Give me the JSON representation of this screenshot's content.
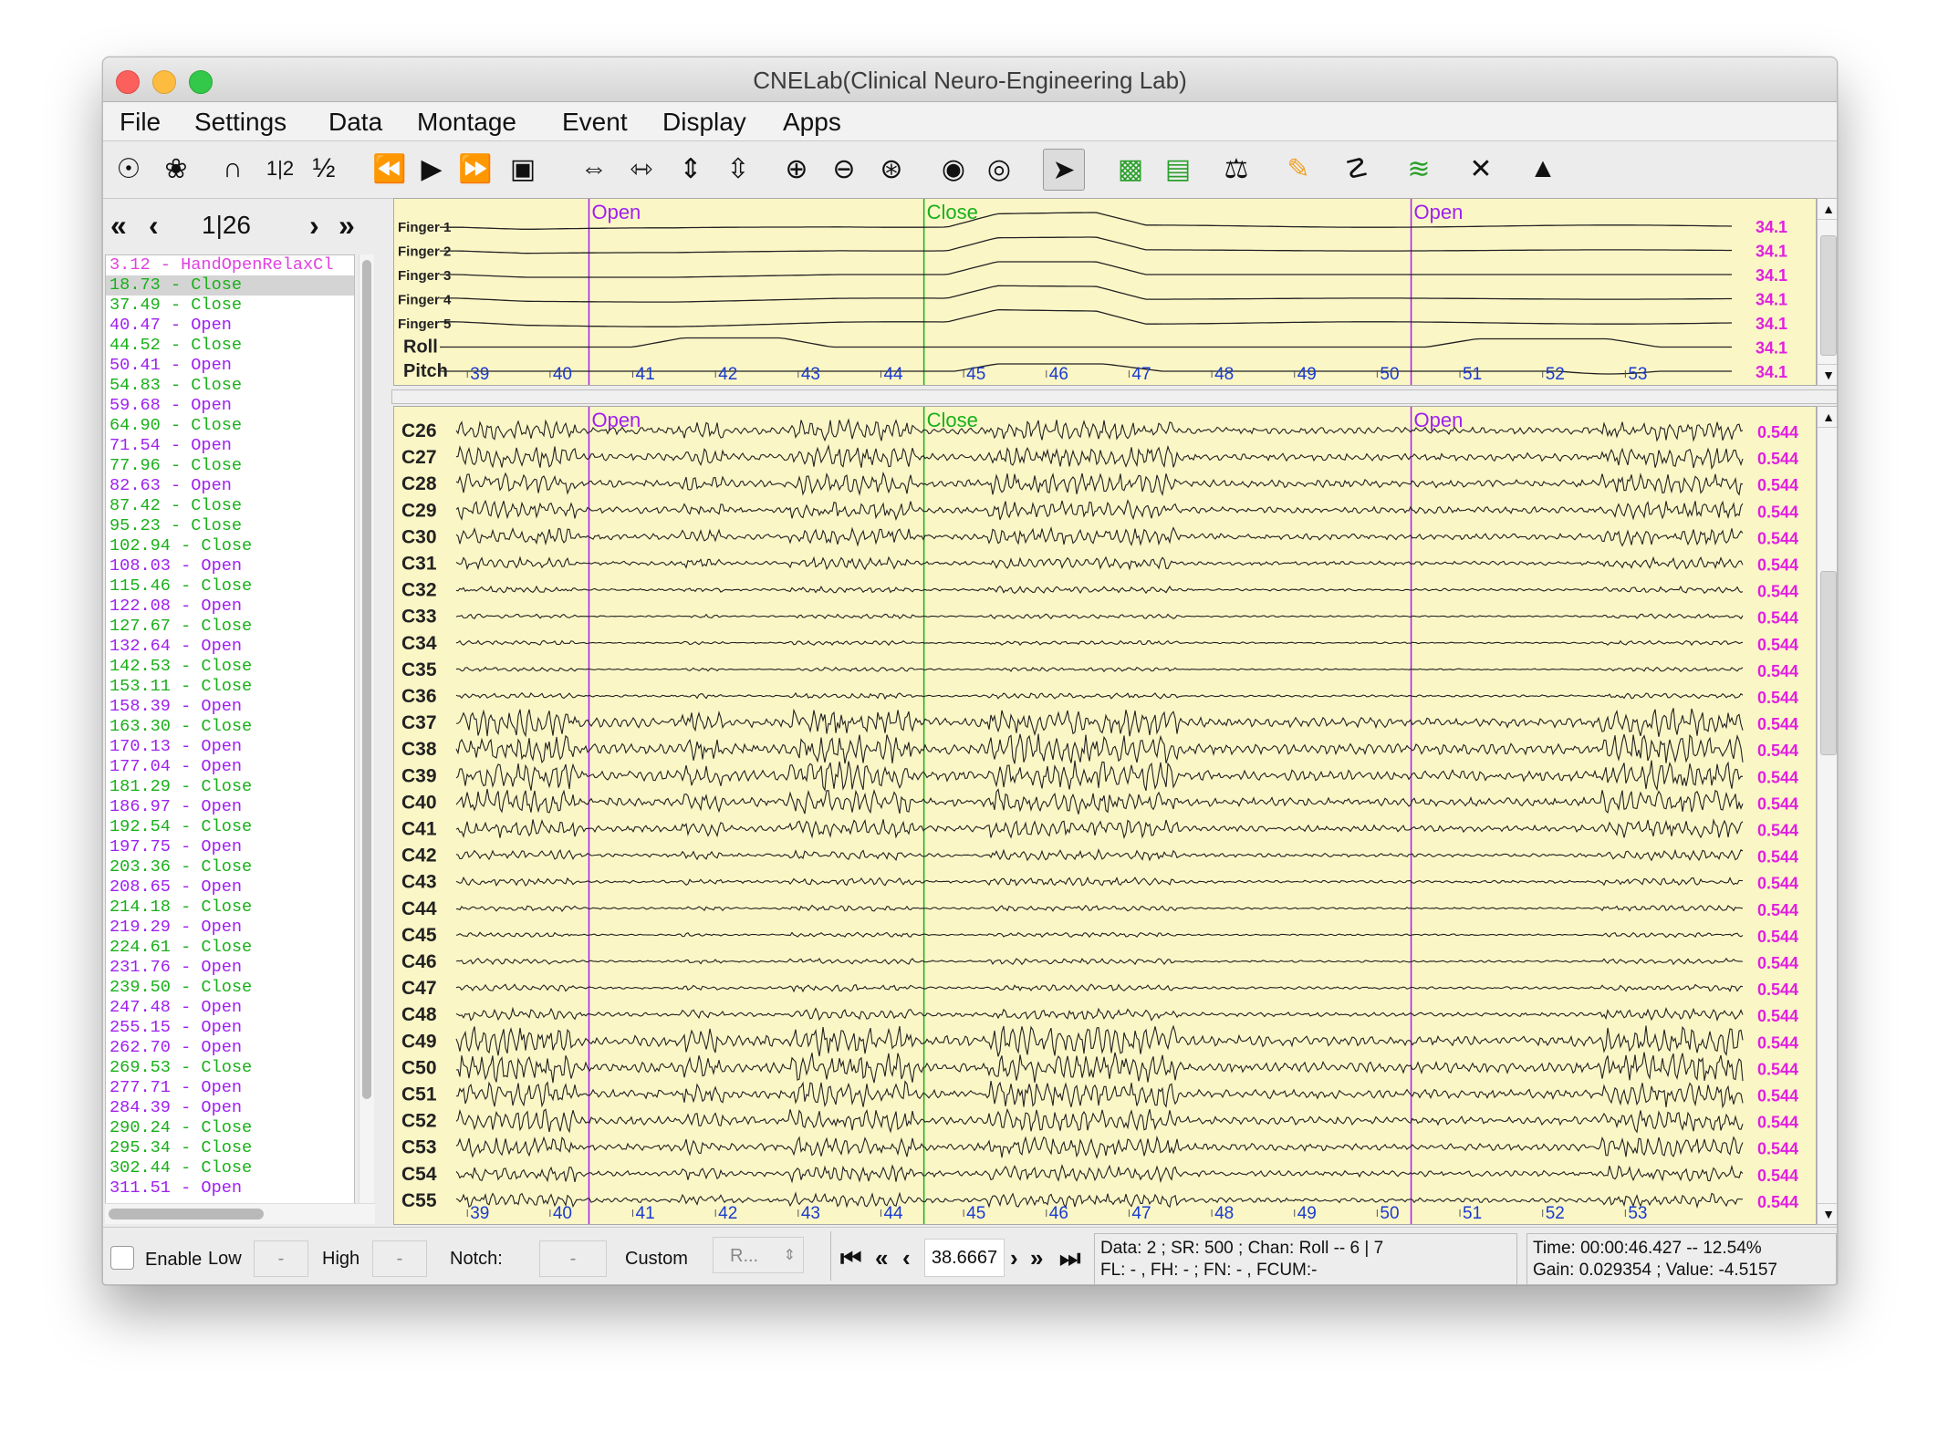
{
  "window": {
    "title": "CNELab(Clinical Neuro-Engineering Lab)"
  },
  "menu": [
    "File",
    "Settings",
    "Data",
    "Montage",
    "Event",
    "Display",
    "Apps"
  ],
  "toolbar": {
    "icons": [
      "electrode-map-icon",
      "electrode-grid-icon",
      "arc-icon",
      "page-1-2-icon",
      "half-icon",
      "rewind-icon",
      "play-icon",
      "fast-forward-icon",
      "video-icon",
      "time-expand-icon",
      "time-compress-icon",
      "amp-expand-icon",
      "amp-compress-icon",
      "zoom-in-icon",
      "zoom-out-icon",
      "zoom-auto-icon",
      "hide-channel-icon",
      "show-channel-icon",
      "cursor-select-icon",
      "select-region-icon",
      "select-rect-icon",
      "balance-icon",
      "pencil-icon",
      "antenna-icon",
      "spectrum-icon",
      "tools-icon",
      "navigate-icon"
    ],
    "glyphs": [
      "☉",
      "❀",
      "∩",
      "1|2",
      "½",
      "⏪",
      "▶",
      "⏩",
      "▣",
      "⇔",
      "⇿",
      "⇕",
      "⇳",
      "⊕",
      "⊖",
      "⊛",
      "◉",
      "◎",
      "➤",
      "▩",
      "▤",
      "⚖",
      "✎",
      "☡",
      "≋",
      "✕",
      "▲"
    ],
    "colors": [
      "#111",
      "#111",
      "#111",
      "#111",
      "#111",
      "#111",
      "#111",
      "#111",
      "#111",
      "#111",
      "#111",
      "#111",
      "#111",
      "#111",
      "#111",
      "#111",
      "#111",
      "#111",
      "#111",
      "#2aa02a",
      "#2aa02a",
      "#111",
      "#f0a020",
      "#111",
      "#2aa02a",
      "#111",
      "#111"
    ]
  },
  "page_nav": {
    "first": "«",
    "prev": "‹",
    "page": "1|26",
    "next": "›",
    "last": "»"
  },
  "events": [
    {
      "text": "3.12 - HandOpenRelaxCl",
      "color": "#e040e0"
    },
    {
      "text": "18.73 - Close",
      "color": "#19b019",
      "selected": true
    },
    {
      "text": "37.49 - Close",
      "color": "#19b019"
    },
    {
      "text": "40.47 - Open",
      "color": "#a020f0"
    },
    {
      "text": "44.52 - Close",
      "color": "#19b019"
    },
    {
      "text": "50.41 - Open",
      "color": "#a020f0"
    },
    {
      "text": "54.83 - Close",
      "color": "#19b019"
    },
    {
      "text": "59.68 - Open",
      "color": "#a020f0"
    },
    {
      "text": "64.90 - Close",
      "color": "#19b019"
    },
    {
      "text": "71.54 - Open",
      "color": "#a020f0"
    },
    {
      "text": "77.96 - Close",
      "color": "#19b019"
    },
    {
      "text": "82.63 - Open",
      "color": "#a020f0"
    },
    {
      "text": "87.42 - Close",
      "color": "#19b019"
    },
    {
      "text": "95.23 - Close",
      "color": "#19b019"
    },
    {
      "text": "102.94 - Close",
      "color": "#19b019"
    },
    {
      "text": "108.03 - Open",
      "color": "#a020f0"
    },
    {
      "text": "115.46 - Close",
      "color": "#19b019"
    },
    {
      "text": "122.08 - Open",
      "color": "#a020f0"
    },
    {
      "text": "127.67 - Close",
      "color": "#19b019"
    },
    {
      "text": "132.64 - Open",
      "color": "#a020f0"
    },
    {
      "text": "142.53 - Close",
      "color": "#19b019"
    },
    {
      "text": "153.11 - Close",
      "color": "#19b019"
    },
    {
      "text": "158.39 - Open",
      "color": "#a020f0"
    },
    {
      "text": "163.30 - Close",
      "color": "#19b019"
    },
    {
      "text": "170.13 - Open",
      "color": "#a020f0"
    },
    {
      "text": "177.04 - Open",
      "color": "#a020f0"
    },
    {
      "text": "181.29 - Close",
      "color": "#19b019"
    },
    {
      "text": "186.97 - Open",
      "color": "#a020f0"
    },
    {
      "text": "192.54 - Close",
      "color": "#19b019"
    },
    {
      "text": "197.75 - Open",
      "color": "#a020f0"
    },
    {
      "text": "203.36 - Close",
      "color": "#19b019"
    },
    {
      "text": "208.65 - Open",
      "color": "#a020f0"
    },
    {
      "text": "214.18 - Close",
      "color": "#19b019"
    },
    {
      "text": "219.29 - Open",
      "color": "#a020f0"
    },
    {
      "text": "224.61 - Close",
      "color": "#19b019"
    },
    {
      "text": "231.76 - Open",
      "color": "#a020f0"
    },
    {
      "text": "239.50 - Close",
      "color": "#19b019"
    },
    {
      "text": "247.48 - Open",
      "color": "#a020f0"
    },
    {
      "text": "255.15 - Open",
      "color": "#a020f0"
    },
    {
      "text": "262.70 - Open",
      "color": "#a020f0"
    },
    {
      "text": "269.53 - Close",
      "color": "#19b019"
    },
    {
      "text": "277.71 - Open",
      "color": "#a020f0"
    },
    {
      "text": "284.39 - Open",
      "color": "#a020f0"
    },
    {
      "text": "290.24 - Close",
      "color": "#19b019"
    },
    {
      "text": "295.34 - Close",
      "color": "#19b019"
    },
    {
      "text": "302.44 - Close",
      "color": "#19b019"
    },
    {
      "text": "311.51 - Open",
      "color": "#a020f0"
    }
  ],
  "time_axis": {
    "start": 38.6667,
    "end": 54.0,
    "ticks": [
      "39",
      "40",
      "41",
      "42",
      "43",
      "44",
      "45",
      "46",
      "47",
      "48",
      "49",
      "50",
      "51",
      "52",
      "53"
    ]
  },
  "markers": [
    {
      "label": "Open",
      "time": 40.47,
      "color": "#a020f0"
    },
    {
      "label": "Close",
      "time": 44.52,
      "color": "#19b019"
    },
    {
      "label": "Open",
      "time": 50.41,
      "color": "#a020f0"
    }
  ],
  "top_channels": [
    {
      "name": "Finger 1",
      "scale": "34.1",
      "bold": false
    },
    {
      "name": "Finger 2",
      "scale": "34.1",
      "bold": false
    },
    {
      "name": "Finger 3",
      "scale": "34.1",
      "bold": false
    },
    {
      "name": "Finger 4",
      "scale": "34.1",
      "bold": false
    },
    {
      "name": "Finger 5",
      "scale": "34.1",
      "bold": false
    },
    {
      "name": "Roll",
      "scale": "34.1",
      "bold": true
    },
    {
      "name": "Pitch",
      "scale": "34.1",
      "bold": true
    }
  ],
  "eeg_channels": [
    {
      "name": "C26",
      "scale": "0.544",
      "amp": 0.9
    },
    {
      "name": "C27",
      "scale": "0.544",
      "amp": 0.95
    },
    {
      "name": "C28",
      "scale": "0.544",
      "amp": 0.95
    },
    {
      "name": "C29",
      "scale": "0.544",
      "amp": 0.8
    },
    {
      "name": "C30",
      "scale": "0.544",
      "amp": 0.75
    },
    {
      "name": "C31",
      "scale": "0.544",
      "amp": 0.5
    },
    {
      "name": "C32",
      "scale": "0.544",
      "amp": 0.3
    },
    {
      "name": "C33",
      "scale": "0.544",
      "amp": 0.2
    },
    {
      "name": "C34",
      "scale": "0.544",
      "amp": 0.2
    },
    {
      "name": "C35",
      "scale": "0.544",
      "amp": 0.18
    },
    {
      "name": "C36",
      "scale": "0.544",
      "amp": 0.25
    },
    {
      "name": "C37",
      "scale": "0.544",
      "amp": 1.2
    },
    {
      "name": "C38",
      "scale": "0.544",
      "amp": 1.3
    },
    {
      "name": "C39",
      "scale": "0.544",
      "amp": 1.3
    },
    {
      "name": "C40",
      "scale": "0.544",
      "amp": 1.1
    },
    {
      "name": "C41",
      "scale": "0.544",
      "amp": 0.8
    },
    {
      "name": "C42",
      "scale": "0.544",
      "amp": 0.45
    },
    {
      "name": "C43",
      "scale": "0.544",
      "amp": 0.35
    },
    {
      "name": "C44",
      "scale": "0.544",
      "amp": 0.25
    },
    {
      "name": "C45",
      "scale": "0.544",
      "amp": 0.2
    },
    {
      "name": "C46",
      "scale": "0.544",
      "amp": 0.25
    },
    {
      "name": "C47",
      "scale": "0.544",
      "amp": 0.3
    },
    {
      "name": "C48",
      "scale": "0.544",
      "amp": 0.5
    },
    {
      "name": "C49",
      "scale": "0.544",
      "amp": 1.3
    },
    {
      "name": "C50",
      "scale": "0.544",
      "amp": 1.3
    },
    {
      "name": "C51",
      "scale": "0.544",
      "amp": 1.1
    },
    {
      "name": "C52",
      "scale": "0.544",
      "amp": 1.0
    },
    {
      "name": "C53",
      "scale": "0.544",
      "amp": 0.9
    },
    {
      "name": "C54",
      "scale": "0.544",
      "amp": 0.7
    },
    {
      "name": "C55",
      "scale": "0.544",
      "amp": 0.6
    }
  ],
  "filters": {
    "enable_label": "Enable",
    "low_label": "Low",
    "low_value": "-",
    "high_label": "High",
    "high_value": "-",
    "notch_label": "Notch:",
    "notch_value": "-",
    "custom_label": "Custom",
    "custom_value": "R..."
  },
  "time_nav": {
    "value": "38.6667"
  },
  "status": {
    "line1": "Data: 2 ; SR: 500 ; Chan: Roll -- 6 | 7",
    "line2": "FL: - , FH: -  ;  FN: - , FCUM:-",
    "line3": "Time: 00:00:46.427 -- 12.54%",
    "line4": "Gain: 0.029354 ; Value: -4.5157"
  },
  "colors": {
    "plot_bg": "#fbf6c6",
    "scale_text": "#e020e0",
    "axis_text": "#1a3bd0",
    "trace": "#222222"
  }
}
